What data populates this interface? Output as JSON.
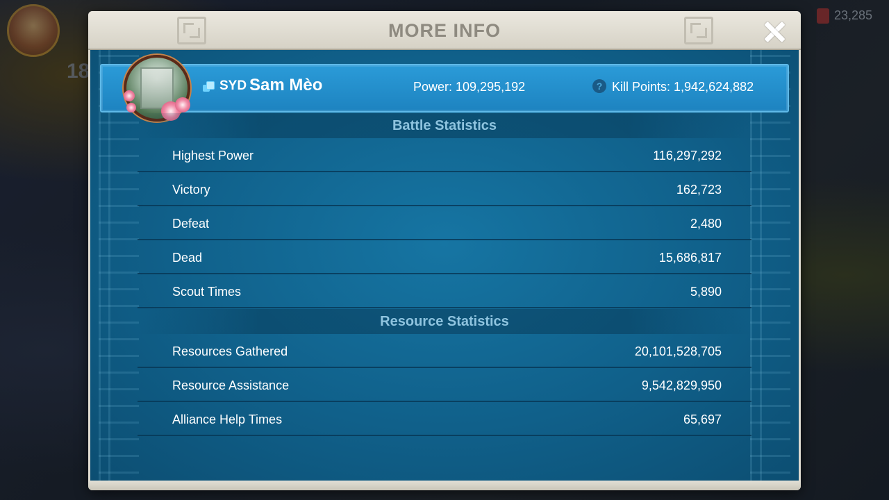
{
  "background": {
    "badge_number": "18",
    "gems": "23,285"
  },
  "header": {
    "title": "MORE INFO"
  },
  "player": {
    "alliance_tag": "SYD",
    "name": "Sam Mèo",
    "power": "Power: 109,295,192",
    "kill_points": "Kill Points: 1,942,624,882",
    "help_glyph": "?"
  },
  "battle": {
    "title": "Battle Statistics",
    "rows": [
      {
        "label": "Highest Power",
        "value": "116,297,292"
      },
      {
        "label": "Victory",
        "value": "162,723"
      },
      {
        "label": "Defeat",
        "value": "2,480"
      },
      {
        "label": "Dead",
        "value": "15,686,817"
      },
      {
        "label": "Scout Times",
        "value": "5,890"
      }
    ]
  },
  "resource": {
    "title": "Resource Statistics",
    "rows": [
      {
        "label": "Resources Gathered",
        "value": "20,101,528,705"
      },
      {
        "label": "Resource Assistance",
        "value": "9,542,829,950"
      },
      {
        "label": "Alliance Help Times",
        "value": "65,697"
      }
    ]
  },
  "colors": {
    "panel_blue": "#10608a",
    "card_blue": "#2290cc",
    "section_title": "#8fc4df"
  }
}
